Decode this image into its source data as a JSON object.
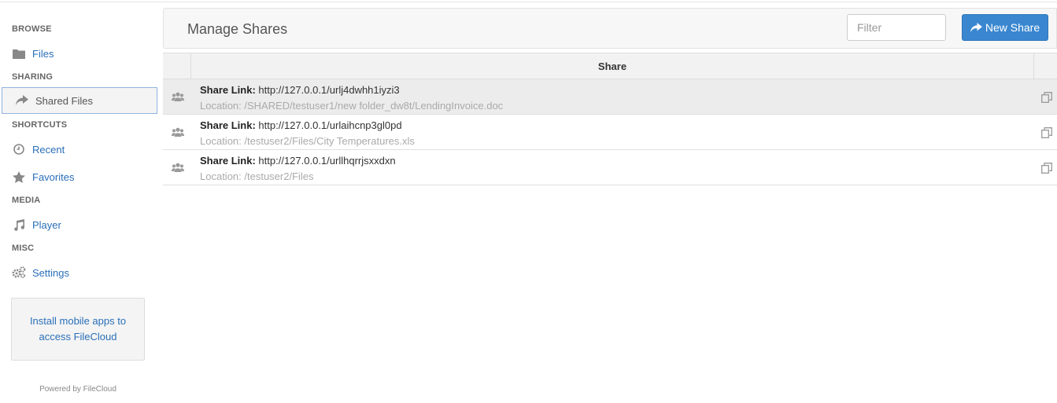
{
  "sidebar": {
    "sections": [
      {
        "heading": "BROWSE",
        "items": [
          {
            "label": "Files",
            "icon": "folder-icon"
          }
        ]
      },
      {
        "heading": "SHARING",
        "items": [
          {
            "label": "Shared Files",
            "icon": "share-arrow-icon",
            "active": true
          }
        ]
      },
      {
        "heading": "SHORTCUTS",
        "items": [
          {
            "label": "Recent",
            "icon": "clock-icon"
          },
          {
            "label": "Favorites",
            "icon": "star-icon"
          }
        ]
      },
      {
        "heading": "MEDIA",
        "items": [
          {
            "label": "Player",
            "icon": "music-note-icon"
          }
        ]
      },
      {
        "heading": "MISC",
        "items": [
          {
            "label": "Settings",
            "icon": "gears-icon"
          }
        ]
      }
    ],
    "promo_text": "Install mobile apps to access FileCloud",
    "powered_by": "Powered by FileCloud"
  },
  "header": {
    "title": "Manage Shares",
    "filter_placeholder": "Filter",
    "new_share_label": "New Share"
  },
  "table": {
    "column_header": "Share",
    "link_label": "Share Link:",
    "rows": [
      {
        "url": "http://127.0.0.1/urlj4dwhh1iyzi3",
        "location": "Location: /SHARED/testuser1/new folder_dw8t/LendingInvoice.doc",
        "selected": true
      },
      {
        "url": "http://127.0.0.1/urlaihcnp3gl0pd",
        "location": "Location: /testuser2/Files/City Temperatures.xls",
        "selected": false
      },
      {
        "url": "http://127.0.0.1/urllhqrrjsxxdxn",
        "location": "Location: /testuser2/Files",
        "selected": false
      }
    ]
  },
  "colors": {
    "accent": "#3a87d0",
    "link": "#2a6fb8",
    "muted": "#aaaaaa"
  }
}
